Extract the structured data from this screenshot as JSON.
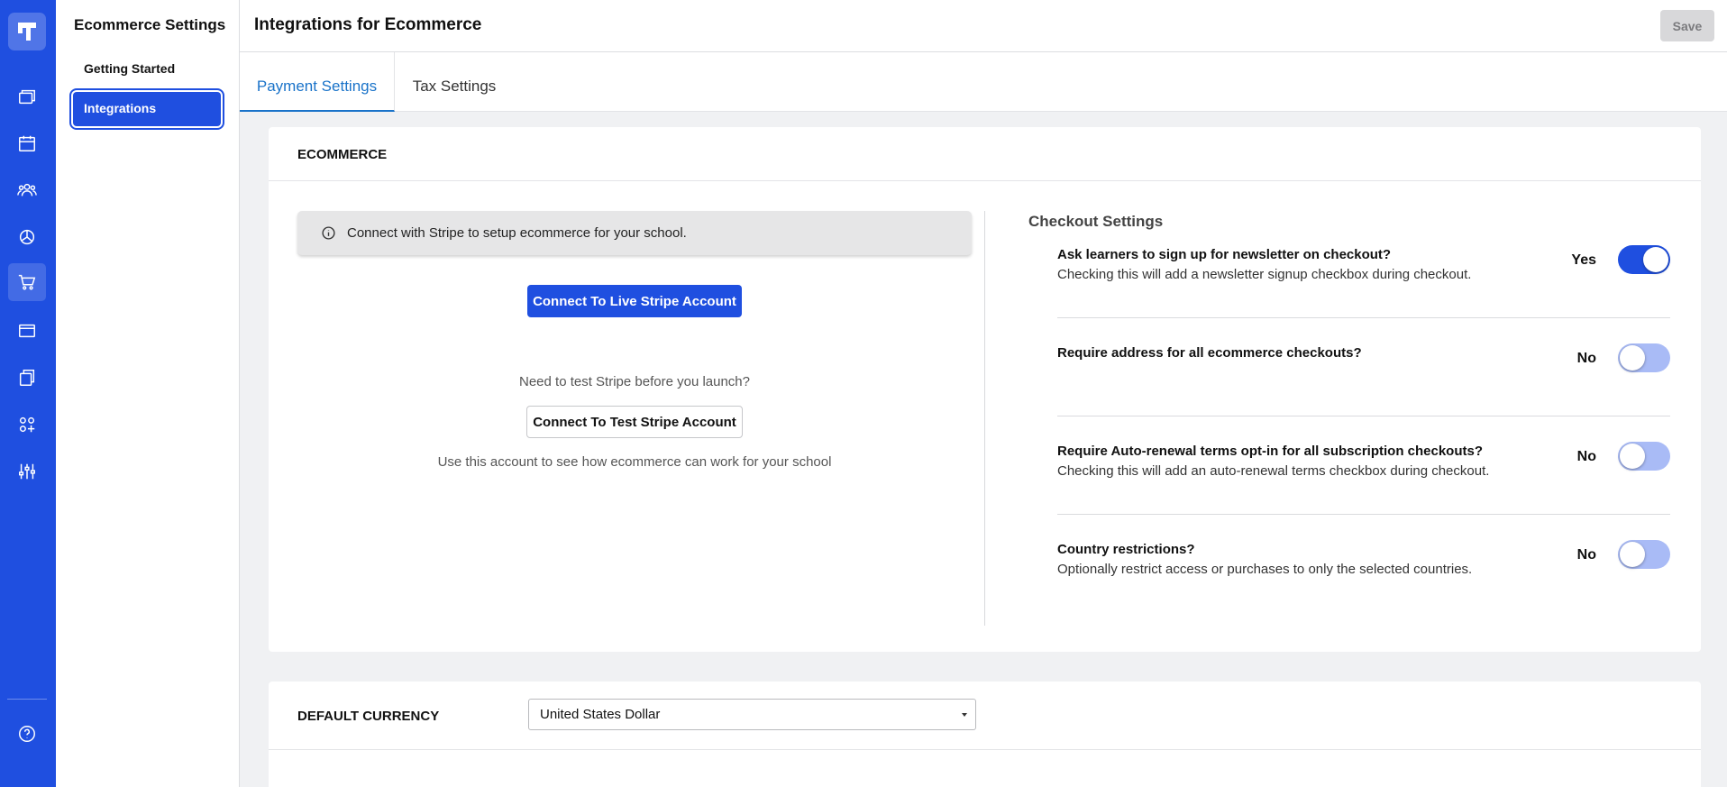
{
  "rail": {
    "icons": [
      "logo-icon",
      "courses-icon",
      "calendar-icon",
      "users-icon",
      "reports-icon",
      "cart-icon",
      "billing-icon",
      "pages-icon",
      "apps-icon",
      "settings-sliders-icon",
      "help-icon"
    ],
    "accent": "#1f4fe0"
  },
  "sidebar": {
    "title": "Ecommerce Settings",
    "items": [
      {
        "label": "Getting Started"
      },
      {
        "label": "Integrations"
      }
    ]
  },
  "header": {
    "title": "Integrations for Ecommerce",
    "save_label": "Save"
  },
  "tabs": [
    {
      "label": "Payment Settings"
    },
    {
      "label": "Tax Settings"
    }
  ],
  "ecommerce": {
    "heading": "ECOMMERCE",
    "notice": "Connect with Stripe to setup ecommerce for your school.",
    "live_button": "Connect To Live Stripe Account",
    "test_question": "Need to test Stripe before you launch?",
    "test_button": "Connect To Test Stripe Account",
    "test_note": "Use this account to see how ecommerce can work for your school"
  },
  "checkout": {
    "title": "Checkout Settings",
    "settings": [
      {
        "question": "Ask learners to sign up for newsletter on checkout?",
        "description": "Checking this will add a newsletter signup checkbox during checkout.",
        "state": "Yes"
      },
      {
        "question": "Require address for all ecommerce checkouts?",
        "description": "",
        "state": "No"
      },
      {
        "question": "Require Auto-renewal terms opt-in for all subscription checkouts?",
        "description": "Checking this will add an auto-renewal terms checkbox during checkout.",
        "state": "No"
      },
      {
        "question": "Country restrictions?",
        "description": "Optionally restrict access or purchases to only the selected countries.",
        "state": "No"
      }
    ]
  },
  "currency": {
    "label": "DEFAULT CURRENCY",
    "selected": "United States Dollar"
  }
}
